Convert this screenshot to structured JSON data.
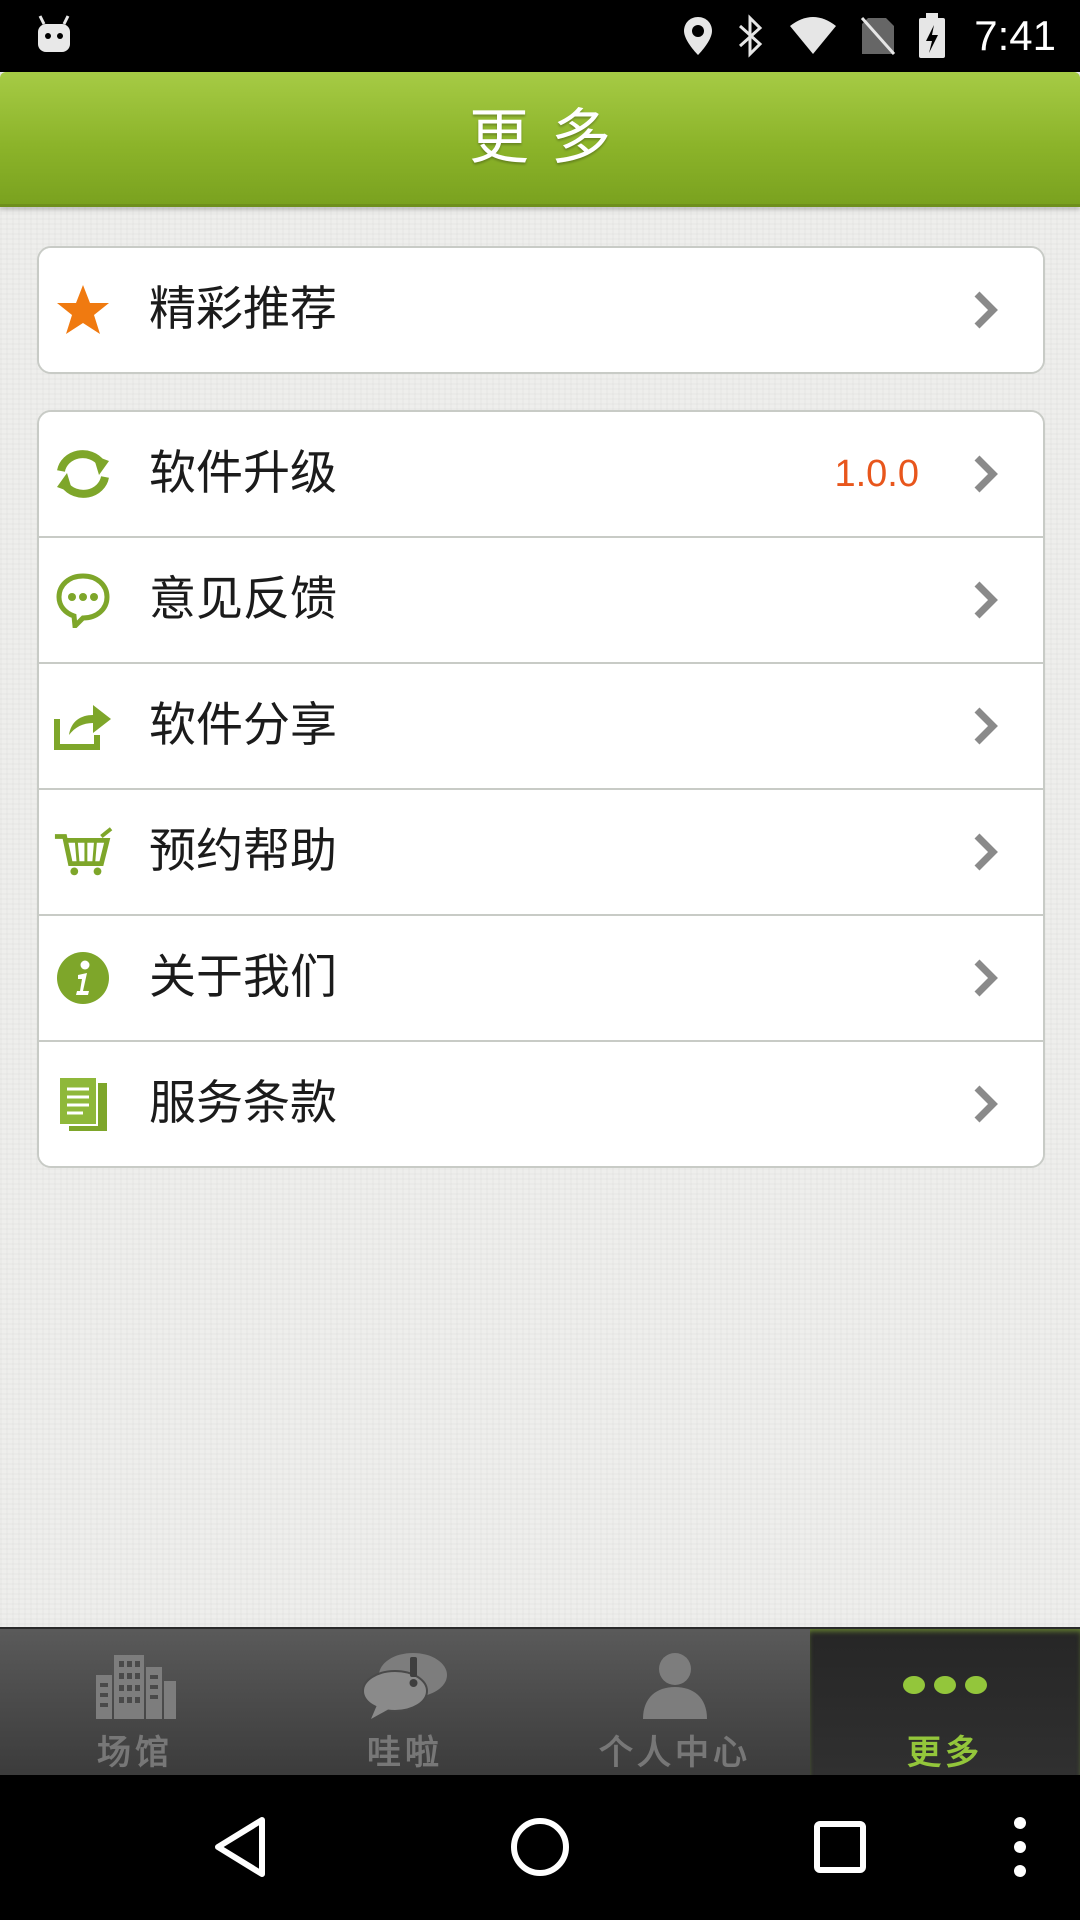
{
  "status_bar": {
    "time": "7:41",
    "icons": [
      "android-icon",
      "location-icon",
      "bluetooth-icon",
      "wifi-icon",
      "no-sim-icon",
      "battery-charging-icon"
    ]
  },
  "header": {
    "title": "更多"
  },
  "card_top": {
    "items": [
      {
        "label": "精彩推荐",
        "icon": "star-icon"
      }
    ]
  },
  "card_main": {
    "items": [
      {
        "label": "软件升级",
        "icon": "refresh-icon",
        "value": "1.0.0"
      },
      {
        "label": "意见反馈",
        "icon": "chat-icon"
      },
      {
        "label": "软件分享",
        "icon": "share-icon"
      },
      {
        "label": "预约帮助",
        "icon": "cart-icon"
      },
      {
        "label": "关于我们",
        "icon": "info-icon"
      },
      {
        "label": "服务条款",
        "icon": "document-icon"
      }
    ]
  },
  "tabbar": {
    "tabs": [
      {
        "label": "场馆",
        "icon": "buildings-icon",
        "active": false
      },
      {
        "label": "哇啦",
        "icon": "speech-bubble-icon",
        "active": false
      },
      {
        "label": "个人中心",
        "icon": "person-icon",
        "active": false
      },
      {
        "label": "更多",
        "icon": "more-dots-icon",
        "active": true
      }
    ]
  },
  "colors": {
    "accent_green": "#8cb42a",
    "value_orange": "#e8561c",
    "icon_green": "#7ea62a",
    "star_orange": "#f07a10"
  }
}
